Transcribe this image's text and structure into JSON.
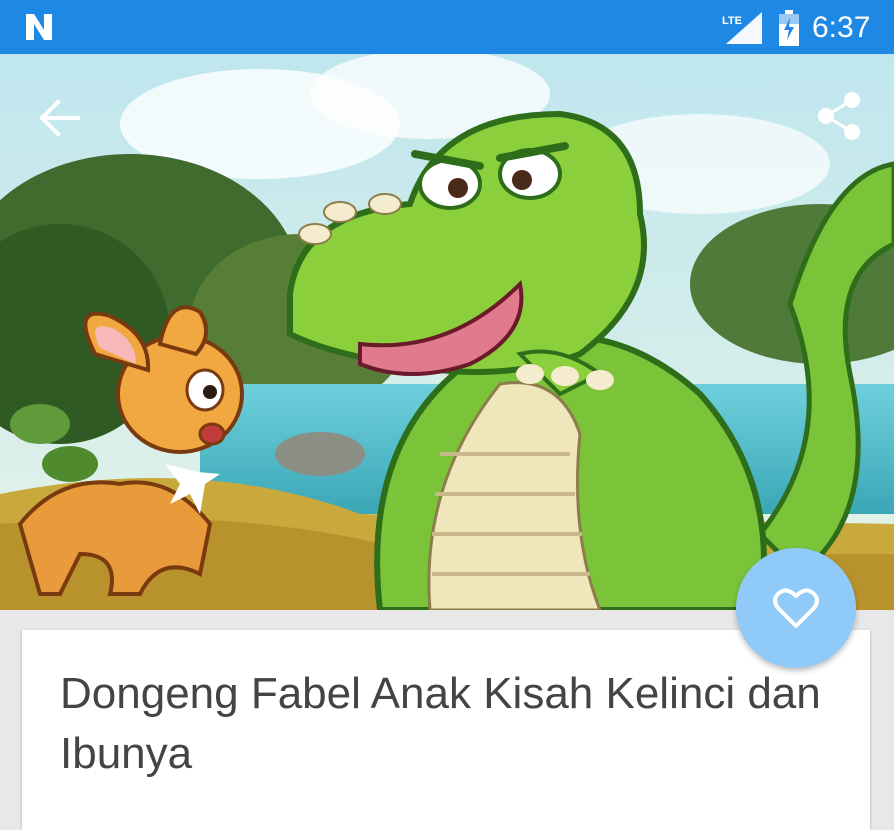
{
  "status_bar": {
    "clock": "6:37",
    "network_label": "LTE",
    "color": "#1e88e5",
    "icons": [
      "n-logo-icon",
      "lte-signal-icon",
      "battery-icon"
    ]
  },
  "toolbar": {
    "back_icon": "arrow-back-icon",
    "share_icon": "share-icon"
  },
  "story": {
    "title": "Dongeng Fabel Anak Kisah Kelinci dan Ibunya"
  },
  "fab": {
    "icon": "heart-outline-icon",
    "color": "#90caf9"
  }
}
